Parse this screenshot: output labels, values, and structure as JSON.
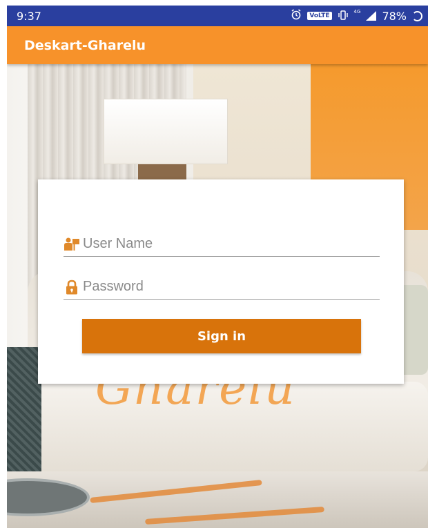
{
  "status_bar": {
    "time": "9:37",
    "volte": "VoLTE",
    "network": "4G",
    "battery": "78%"
  },
  "app_bar": {
    "title": "Deskart-Gharelu"
  },
  "login": {
    "username_placeholder": "User Name",
    "username_value": "",
    "password_placeholder": "Password",
    "password_value": "",
    "signin_label": "Sign in"
  },
  "background": {
    "script_text": "Gharelu"
  },
  "colors": {
    "status_bar": "#2a3f9f",
    "app_bar": "#f7922a",
    "button": "#d8730b",
    "icon": "#e0892a"
  },
  "icons": [
    "alarm-icon",
    "vibrate-icon",
    "signal-icon",
    "battery-icon",
    "user-icon",
    "lock-icon"
  ]
}
